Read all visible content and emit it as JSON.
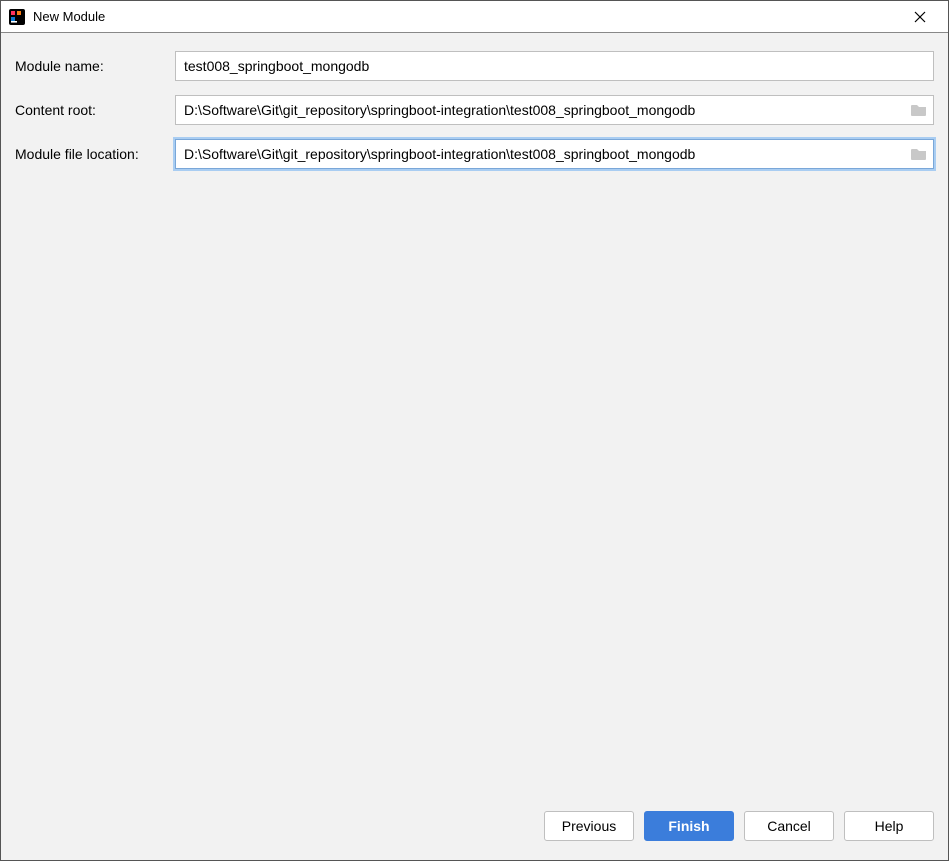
{
  "dialog": {
    "title": "New Module"
  },
  "form": {
    "module_name": {
      "label": "Module name:",
      "value": "test008_springboot_mongodb"
    },
    "content_root": {
      "label": "Content root:",
      "value": "D:\\Software\\Git\\git_repository\\springboot-integration\\test008_springboot_mongodb"
    },
    "module_file_location": {
      "label": "Module file location:",
      "value": "D:\\Software\\Git\\git_repository\\springboot-integration\\test008_springboot_mongodb"
    }
  },
  "buttons": {
    "previous": "Previous",
    "finish": "Finish",
    "cancel": "Cancel",
    "help": "Help"
  }
}
